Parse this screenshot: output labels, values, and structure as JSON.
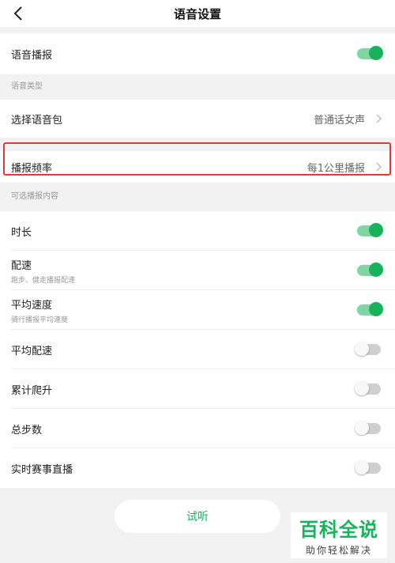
{
  "header": {
    "title": "语音设置"
  },
  "voice_broadcast": {
    "label": "语音播报",
    "enabled": true
  },
  "voice_type": {
    "section_label": "语音类型",
    "select_pack_label": "选择语音包",
    "select_pack_value": "普通话女声"
  },
  "frequency": {
    "label": "播报频率",
    "value": "每1公里播报"
  },
  "optional": {
    "section_label": "可选播报内容",
    "items": [
      {
        "label": "时长",
        "sub": "",
        "enabled": true
      },
      {
        "label": "配速",
        "sub": "跑步、健走播报配速",
        "enabled": true
      },
      {
        "label": "平均速度",
        "sub": "骑行播报平均速度",
        "enabled": true
      },
      {
        "label": "平均配速",
        "sub": "",
        "enabled": false
      },
      {
        "label": "累计爬升",
        "sub": "",
        "enabled": false
      },
      {
        "label": "总步数",
        "sub": "",
        "enabled": false
      },
      {
        "label": "实时赛事直播",
        "sub": "",
        "enabled": false
      }
    ]
  },
  "listen_button": {
    "label": "试听"
  },
  "watermark": {
    "main": "百科全说",
    "sub": "助你轻松解决"
  },
  "colors": {
    "accent": "#16b35a",
    "highlight": "#e53935"
  }
}
